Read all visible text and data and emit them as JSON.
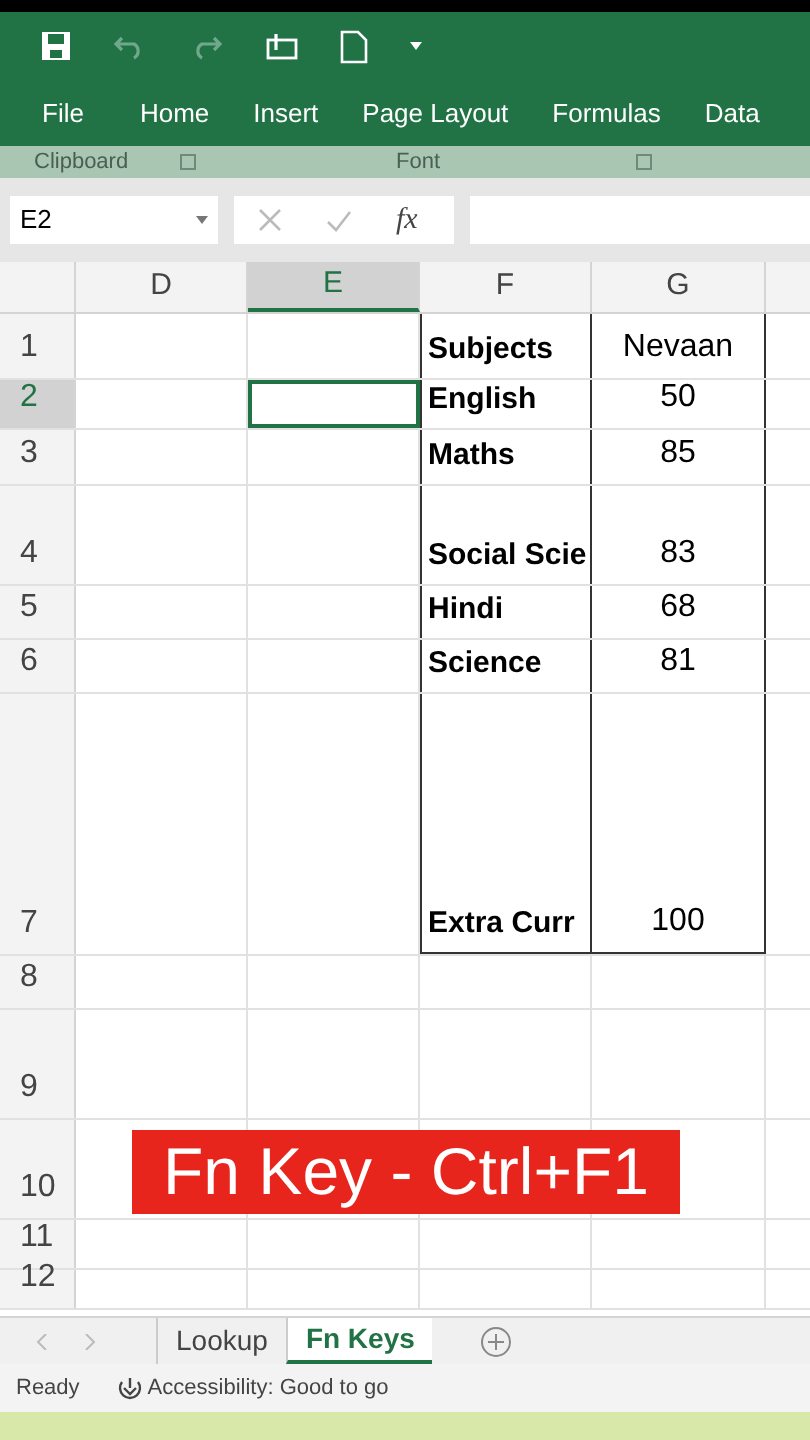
{
  "ribbon_tabs": [
    "File",
    "Home",
    "Insert",
    "Page Layout",
    "Formulas",
    "Data"
  ],
  "ribbon_groups": [
    "Clipboard",
    "Font"
  ],
  "name_box": {
    "value": "E2"
  },
  "formula_bar": {
    "function_label": "fx"
  },
  "columns": [
    {
      "label": "D",
      "selected": false
    },
    {
      "label": "E",
      "selected": true
    },
    {
      "label": "F",
      "selected": false
    },
    {
      "label": "G",
      "selected": false
    }
  ],
  "rows": [
    {
      "number": "1",
      "selected": false,
      "F": "Subjects",
      "G": "Nevaan"
    },
    {
      "number": "2",
      "selected": true,
      "F": "English",
      "G": "50"
    },
    {
      "number": "3",
      "selected": false,
      "F": "Maths",
      "G": "85"
    },
    {
      "number": "4",
      "selected": false,
      "F": "Social Scie",
      "G": "83"
    },
    {
      "number": "5",
      "selected": false,
      "F": "Hindi",
      "G": "68"
    },
    {
      "number": "6",
      "selected": false,
      "F": "Science",
      "G": "81"
    },
    {
      "number": "7",
      "selected": false,
      "F": "Extra Curr",
      "G": "100"
    },
    {
      "number": "8",
      "selected": false
    },
    {
      "number": "9",
      "selected": false
    },
    {
      "number": "10",
      "selected": false
    },
    {
      "number": "11",
      "selected": false
    },
    {
      "number": "12",
      "selected": false
    }
  ],
  "caption": "Fn Key - Ctrl+F1",
  "sheet_tabs": [
    {
      "label": "Lookup",
      "selected": false
    },
    {
      "label": "Fn Keys",
      "selected": true
    }
  ],
  "status_bar": {
    "mode": "Ready",
    "accessibility": "Accessibility: Good to go"
  }
}
